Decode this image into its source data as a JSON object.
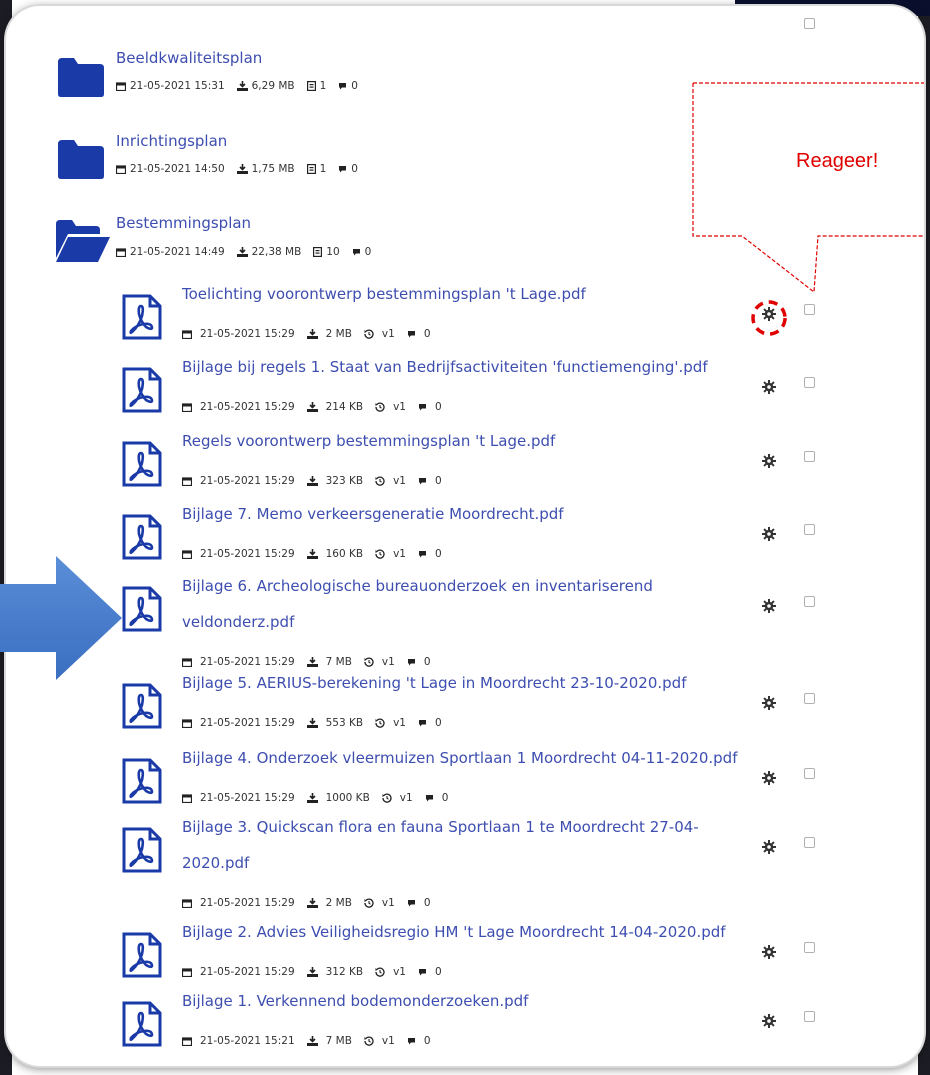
{
  "folders": [
    {
      "name": "Beeldkwaliteitsplan",
      "date": "21-05-2021 15:31",
      "size": "6,29 MB",
      "files": "1",
      "comments": "0"
    },
    {
      "name": "Inrichtingsplan",
      "date": "21-05-2021 14:50",
      "size": "1,75 MB",
      "files": "1",
      "comments": "0"
    },
    {
      "name": "Bestemmingsplan",
      "date": "21-05-2021 14:49",
      "size": "22,38 MB",
      "files": "10",
      "comments": "0"
    }
  ],
  "files": [
    {
      "line1": "Toelichting voorontwerp bestemmingsplan 't Lage.pdf",
      "line2": "",
      "date": "21-05-2021 15:29",
      "size": "2 MB",
      "version": "v1",
      "comments": "0"
    },
    {
      "line1": "Bijlage bij regels 1. Staat van Bedrijfsactiviteiten 'functiemenging'.pdf",
      "line2": "",
      "date": "21-05-2021 15:29",
      "size": "214 KB",
      "version": "v1",
      "comments": "0"
    },
    {
      "line1": "Regels voorontwerp bestemmingsplan 't Lage.pdf",
      "line2": "",
      "date": "21-05-2021 15:29",
      "size": "323 KB",
      "version": "v1",
      "comments": "0"
    },
    {
      "line1": "Bijlage 7. Memo verkeersgeneratie Moordrecht.pdf",
      "line2": "",
      "date": "21-05-2021 15:29",
      "size": "160 KB",
      "version": "v1",
      "comments": "0"
    },
    {
      "line1": "Bijlage 6. Archeologische bureauonderzoek en inventariserend",
      "line2": "veldonderz.pdf",
      "date": "21-05-2021 15:29",
      "size": "7 MB",
      "version": "v1",
      "comments": "0"
    },
    {
      "line1": "Bijlage 5. AERIUS-berekening 't Lage in Moordrecht 23-10-2020.pdf",
      "line2": "",
      "date": "21-05-2021 15:29",
      "size": "553 KB",
      "version": "v1",
      "comments": "0"
    },
    {
      "line1": "Bijlage 4. Onderzoek vleermuizen Sportlaan 1 Moordrecht 04-11-2020.pdf",
      "line2": "",
      "date": "21-05-2021 15:29",
      "size": "1000 KB",
      "version": "v1",
      "comments": "0"
    },
    {
      "line1": "Bijlage 3. Quickscan flora en fauna Sportlaan 1 te Moordrecht 27-04-",
      "line2": "2020.pdf",
      "date": "21-05-2021 15:29",
      "size": "2 MB",
      "version": "v1",
      "comments": "0"
    },
    {
      "line1": "Bijlage 2. Advies Veiligheidsregio HM 't Lage Moordrecht 14-04-2020.pdf",
      "line2": "",
      "date": "21-05-2021 15:29",
      "size": "312 KB",
      "version": "v1",
      "comments": "0"
    },
    {
      "line1": "Bijlage 1. Verkennend bodemonderzoeken.pdf",
      "line2": "",
      "date": "21-05-2021 15:21",
      "size": "7 MB",
      "version": "v1",
      "comments": "0"
    }
  ],
  "callout": {
    "text": "Reageer!",
    "color": "#e00000"
  },
  "colors": {
    "link": "#3d4eb0",
    "icon_blue": "#1a3aa8",
    "arrow": "#4a7fd0"
  },
  "icons": {
    "folder": "folder-icon",
    "folder_open": "folder-open-icon",
    "pdf": "pdf-file-icon",
    "date": "calendar-icon",
    "size": "download-icon",
    "files": "file-count-icon",
    "version": "history-icon",
    "comments": "comment-icon",
    "actions": "gear-icon"
  }
}
